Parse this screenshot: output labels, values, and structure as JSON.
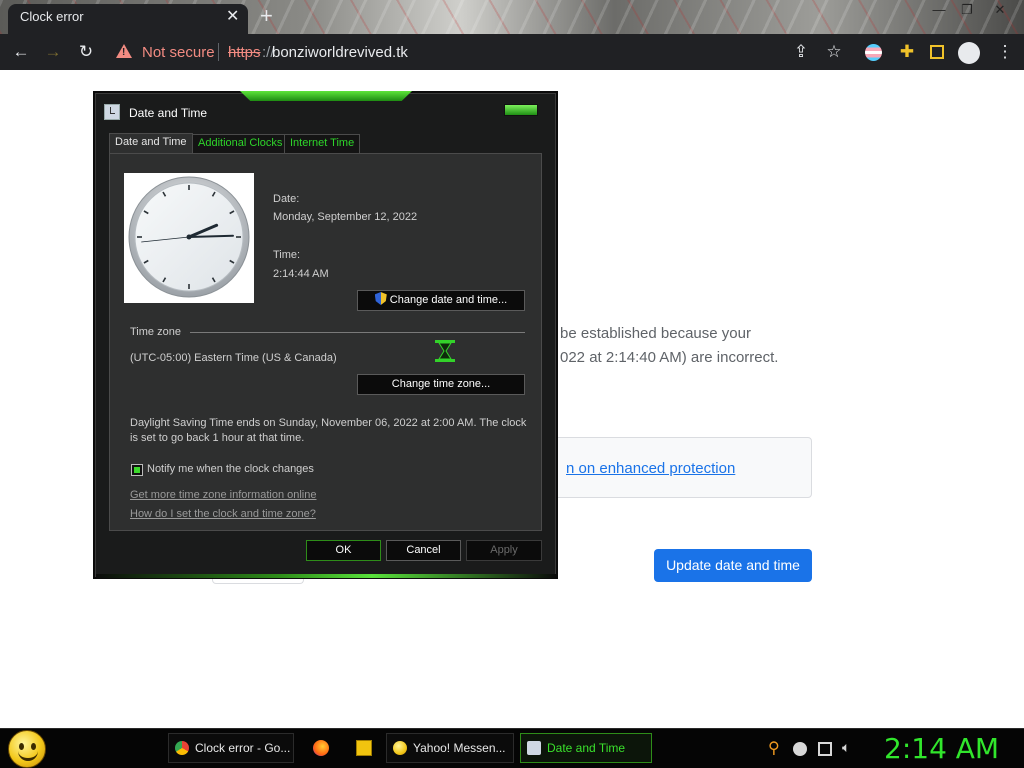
{
  "browser": {
    "tab_title": "Clock error",
    "tab_close": "✕",
    "new_tab": "+",
    "security_label": "Not secure",
    "url_scheme": "https",
    "url_slashes": "://",
    "url_host": "bonziworldrevived.tk"
  },
  "page": {
    "text_line_1": "be established because your",
    "text_line_2": "022 at 2:14:40 AM) are incorrect.",
    "enhanced_link": "n on enhanced protection",
    "update_button": "Update date and time"
  },
  "dialog": {
    "title": "Date and Time",
    "tabs": [
      "Date and Time",
      "Additional Clocks",
      "Internet Time"
    ],
    "date_label": "Date:",
    "date_value": "Monday, September 12, 2022",
    "time_label": "Time:",
    "time_value": "2:14:44 AM",
    "change_datetime_button": "Change date and time...",
    "timezone_label": "Time zone",
    "timezone_value": "(UTC-05:00) Eastern Time (US & Canada)",
    "change_timezone_button": "Change time zone...",
    "dst_text": "Daylight Saving Time ends on Sunday, November 06, 2022 at 2:00 AM. The clock is set to go back 1 hour at that time.",
    "notify_label": "Notify me when the clock changes",
    "notify_checked": true,
    "link_tz_info": "Get more time zone information online",
    "link_howto": "How do I set the clock and time zone?",
    "ok_button": "OK",
    "cancel_button": "Cancel",
    "apply_button": "Apply",
    "clock": {
      "hours": 2,
      "minutes": 14,
      "seconds": 44
    }
  },
  "taskbar": {
    "items": [
      {
        "label": "Clock error - Go...",
        "icon": "chrome-icon"
      },
      {
        "label": "Yahoo! Messen...",
        "icon": "yahoo-messenger-icon"
      },
      {
        "label": "Date and Time",
        "icon": "date-time-icon"
      }
    ],
    "quick_launch": [
      "firefox-icon",
      "folder-icon"
    ],
    "tray_icons": [
      "search-icon",
      "messenger-status-icon",
      "network-icon",
      "volume-icon"
    ],
    "clock": "2:14 AM"
  },
  "colors": {
    "accent_green": "#31e62c",
    "chrome_blue": "#1a73e8",
    "insecure_red": "#f28b82"
  }
}
